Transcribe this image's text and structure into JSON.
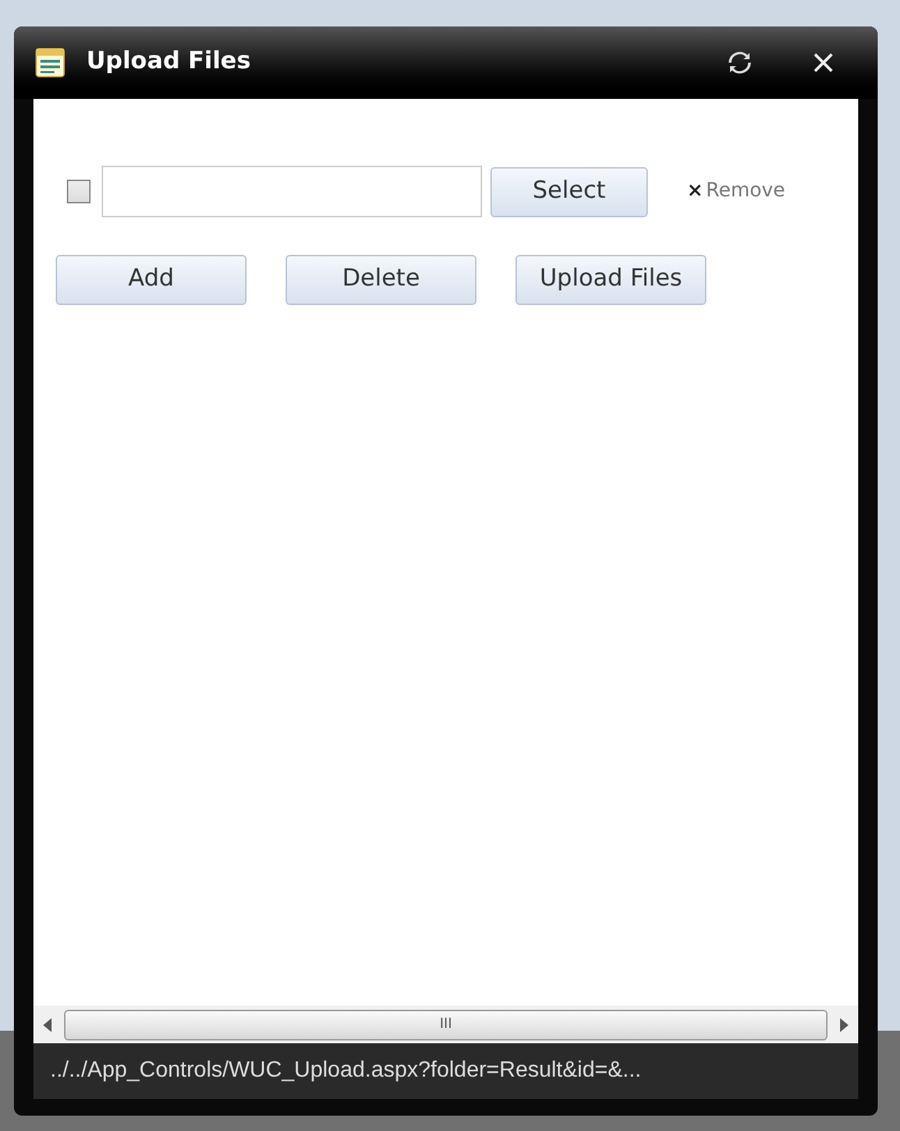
{
  "window": {
    "title": "Upload Files"
  },
  "file_row": {
    "checked": false,
    "select_button": "Select",
    "remove_link": "Remove",
    "remove_glyph": "×"
  },
  "buttons": [
    "Add",
    "Delete",
    "Upload Files"
  ],
  "scrollbar": {
    "grip": "III"
  },
  "status_bar": "../../App_Controls/WUC_Upload.aspx?folder=Result&id=&..."
}
